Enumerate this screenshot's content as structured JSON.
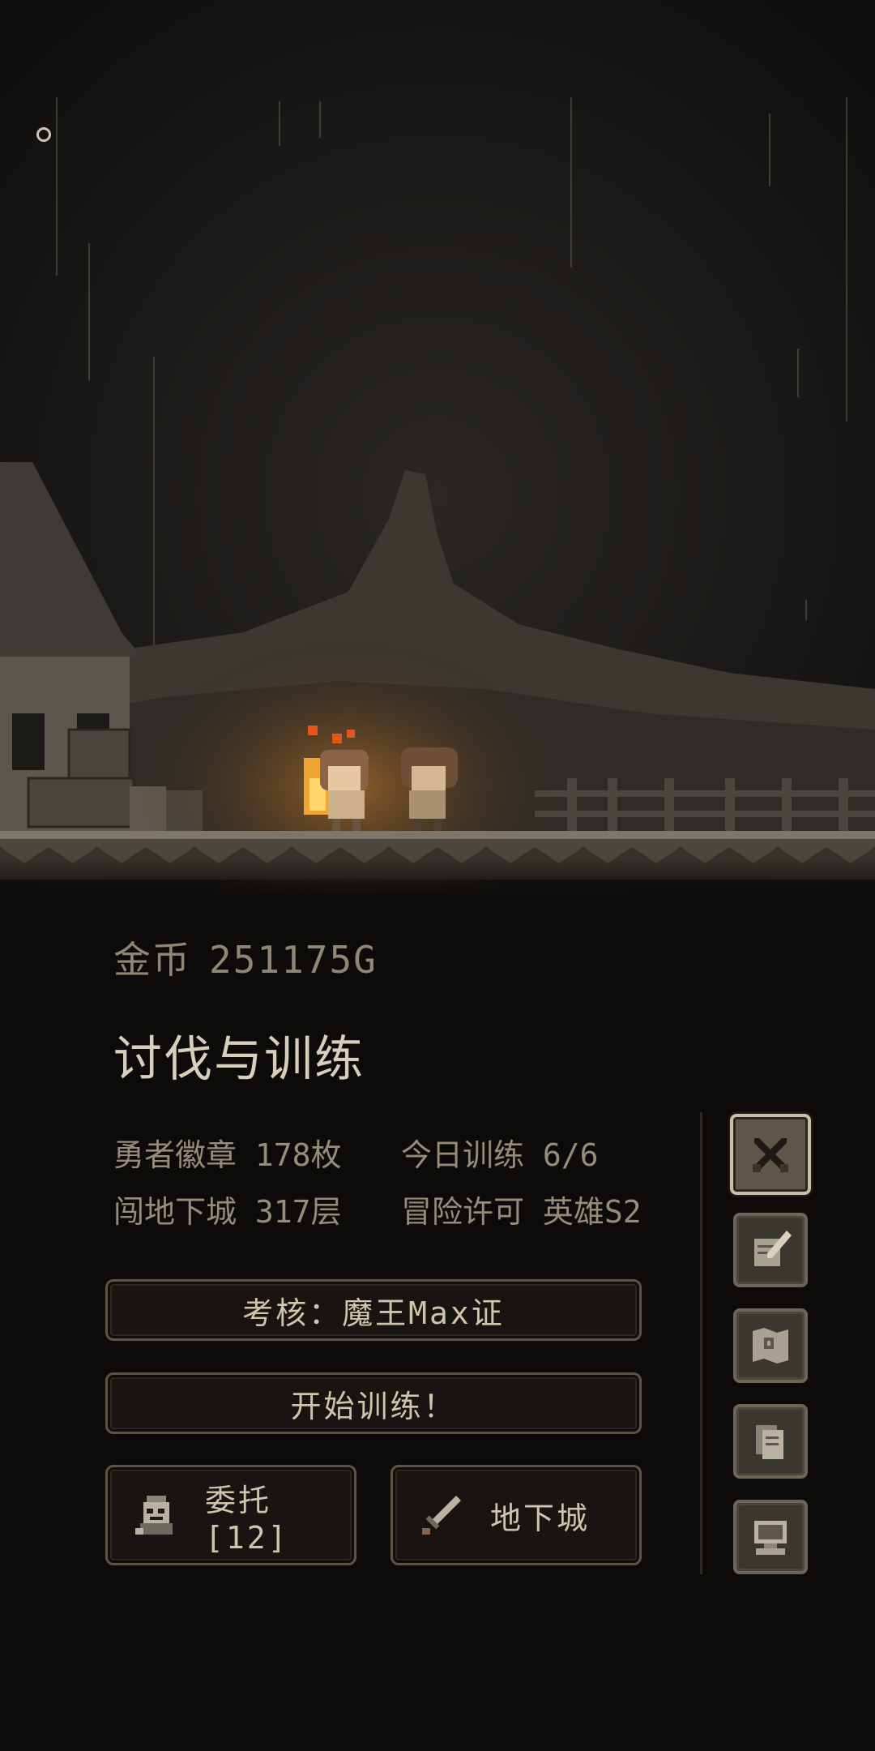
{
  "status": {
    "gold_label": "金币",
    "gold_value": "251175G"
  },
  "panel": {
    "title": "讨伐与训练",
    "stats": {
      "badges": "勇者徽章 178枚",
      "training_today": "今日训练 6/6",
      "dungeon_depth": "闯地下城 317层",
      "license": "冒险许可 英雄S2"
    }
  },
  "buttons": {
    "exam": "考核：魔王Max证",
    "start_training": "开始训练！",
    "commission": "委托[12]",
    "dungeon": "地下城"
  },
  "side_menu": [
    {
      "icon": "crossed-swords-icon",
      "active": true
    },
    {
      "icon": "scroll-quill-icon",
      "active": false
    },
    {
      "icon": "map-icon",
      "active": false
    },
    {
      "icon": "documents-icon",
      "active": false
    },
    {
      "icon": "computer-icon",
      "active": false
    }
  ],
  "colors": {
    "background": "#0d0b09",
    "text_primary": "#d8cfba",
    "text_secondary": "#968c78",
    "button_border": "#5b5343",
    "fire": "#f5a623"
  }
}
